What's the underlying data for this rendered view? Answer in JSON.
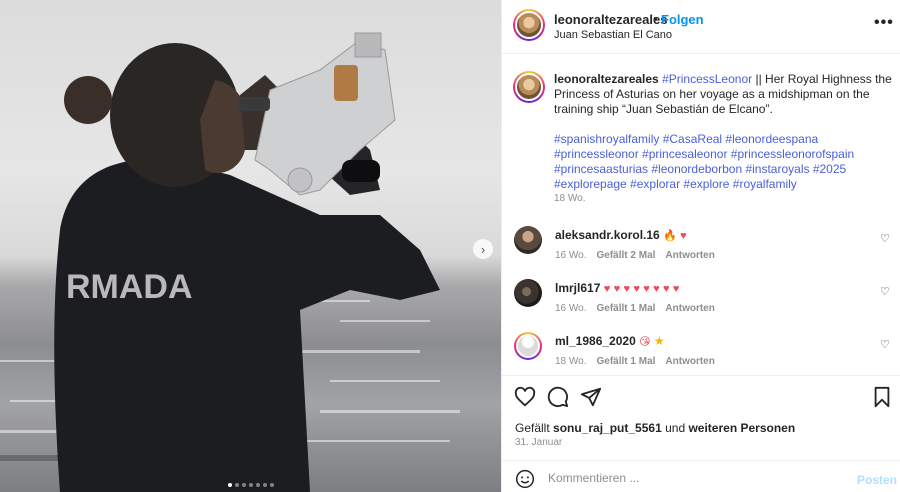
{
  "post": {
    "username": "leonoraltezareales",
    "separator": "•",
    "follow_label": "Folgen",
    "location": "Juan Sebastian El Cano",
    "more_label": "•••"
  },
  "photo": {
    "jacket_text": "RMADA",
    "carousel_total": 7,
    "carousel_active": 1
  },
  "caption": {
    "username": "leonoraltezareales",
    "mention": "#PrincessLeonor",
    "text": " || Her Royal Highness the Princess of Asturias on her voyage as a midshipman on the training ship “Juan Sebastián de Elcano”.",
    "hashtags": "#spanishroyalfamily #CasaReal #leonordeespana #princessleonor #princesaleonor #princessleonorofspain #princesaasturias #leonordeborbon #instaroyals #2025 #explorepage #explorar #explore #royalfamily",
    "time": "18 Wo."
  },
  "comments": [
    {
      "username": "aleksandr.korol.16",
      "emoji": [
        "🔥",
        "♥"
      ],
      "time": "16 Wo.",
      "likes": "Gefällt 2 Mal",
      "reply": "Antworten"
    },
    {
      "username": "lmrjl617",
      "emoji": [
        "♥",
        "♥",
        "♥",
        "♥",
        "♥",
        "♥",
        "♥",
        "♥"
      ],
      "time": "16 Wo.",
      "likes": "Gefällt 1 Mal",
      "reply": "Antworten"
    },
    {
      "username": "ml_1986_2020",
      "emoji": [
        "😘",
        "★"
      ],
      "time": "18 Wo.",
      "likes": "Gefällt 1 Mal",
      "reply": "Antworten"
    }
  ],
  "likes": {
    "prefix": "Gefällt",
    "user": "sonu_raj_put_5561",
    "middle": "und",
    "suffix": "weiteren Personen"
  },
  "date": "31. Januar",
  "comment_bar": {
    "placeholder": "Kommentieren ...",
    "post_label": "Posten"
  },
  "colors": {
    "accent": "#0095f6",
    "hashtag": "#4a5fd9",
    "heart": "#ed4956",
    "muted": "#8e8e8e"
  }
}
